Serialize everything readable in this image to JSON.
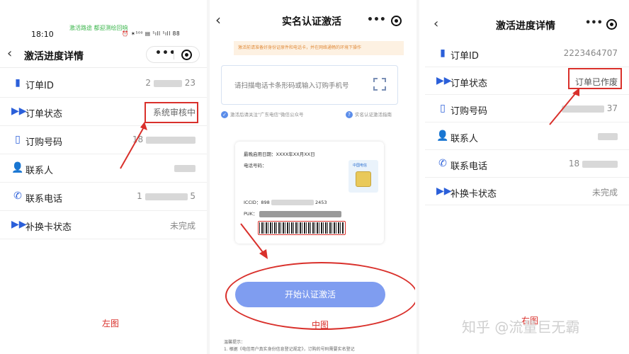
{
  "left": {
    "status_banner": "激活路途 都迎测绘回响",
    "time": "18:10",
    "status_icons": "⏰ ✶⁵⁰⁰ ▤ ⁵ıll ⁵ıll 88",
    "title": "激活进度详情",
    "rows": [
      {
        "label": "订单ID",
        "value_prefix": "2",
        "value_suffix": "23",
        "icon": "document-icon"
      },
      {
        "label": "订单状态",
        "value": "系统审核中",
        "icon": "double-arrow-icon"
      },
      {
        "label": "订购号码",
        "value_prefix": "18",
        "value_suffix": "",
        "icon": "phone-icon"
      },
      {
        "label": "联系人",
        "value_prefix": "",
        "value_suffix": "",
        "icon": "person-add-icon"
      },
      {
        "label": "联系电话",
        "value_prefix": "1",
        "value_suffix": "5",
        "icon": "handset-icon"
      },
      {
        "label": "补换卡状态",
        "value": "未完成",
        "icon": "double-arrow-icon"
      }
    ],
    "caption": "左图"
  },
  "middle": {
    "title": "实名认证激活",
    "notice": "激活前请准备好身份证原件和电话卡，并在网络通畅的环境下操作",
    "scan_placeholder": "请扫描电话卡条形码或输入订购手机号",
    "link_left": "激活后请关注\"广东电信\"微信公众号",
    "link_right": "实名认证激活指南",
    "card": {
      "expire": "最晚启用日期：XXXX年XX月XX日",
      "phone": "电话号码：",
      "iccid": "ICCID：898",
      "iccid_suffix": "2453",
      "puk": "PUK：",
      "sim_logo": "中国电信"
    },
    "button": "开始认证激活",
    "caption": "中图",
    "notes_title": "温馨提示：",
    "notes_line": "1. 根据《电信用户真实身份信息登记规定》，订购的号码需要实名登记"
  },
  "right": {
    "title": "激活进度详情",
    "rows": [
      {
        "label": "订单ID",
        "value": "2223464707",
        "icon": "document-icon"
      },
      {
        "label": "订单状态",
        "value": "订单已作废",
        "icon": "double-arrow-icon"
      },
      {
        "label": "订购号码",
        "value_prefix": "",
        "value_suffix": "37",
        "icon": "phone-icon"
      },
      {
        "label": "联系人",
        "value_prefix": "",
        "value_suffix": "",
        "icon": "person-add-icon"
      },
      {
        "label": "联系电话",
        "value_prefix": "18",
        "value_suffix": "",
        "icon": "handset-icon"
      },
      {
        "label": "补换卡状态",
        "value": "未完成",
        "icon": "double-arrow-icon"
      }
    ],
    "caption": "右图"
  },
  "watermark": "知乎 @流量巨无霸",
  "colors": {
    "accent": "#2b5fd9",
    "highlight": "#d9302b",
    "button": "#7f9df0"
  }
}
